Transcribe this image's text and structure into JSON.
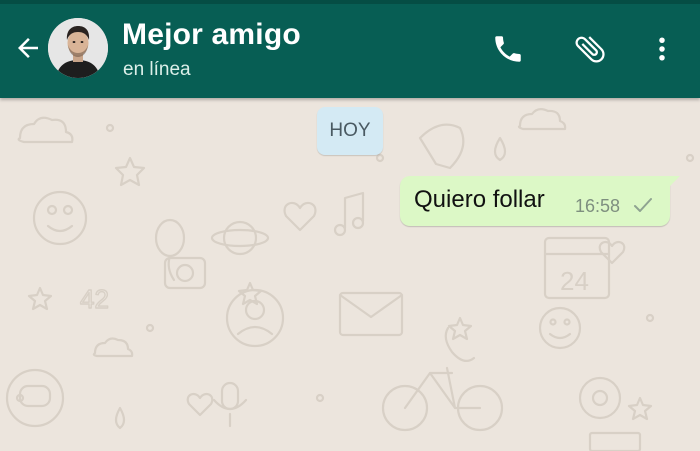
{
  "header": {
    "back_icon": "arrow-left-icon",
    "contact_name": "Mejor amigo",
    "status": "en línea",
    "actions": [
      {
        "icon": "phone-icon"
      },
      {
        "icon": "paperclip-icon"
      },
      {
        "icon": "more-vertical-icon"
      }
    ],
    "color": "#075e54"
  },
  "chat": {
    "date_label": "HOY",
    "messages": [
      {
        "direction": "outgoing",
        "text": "Quiero follar",
        "time": "16:58",
        "status_icon": "single-check-icon"
      }
    ],
    "wallpaper_color": "#ece5dd",
    "outgoing_bubble_color": "#dcf8c6",
    "date_chip_color": "#d4eaf4"
  }
}
